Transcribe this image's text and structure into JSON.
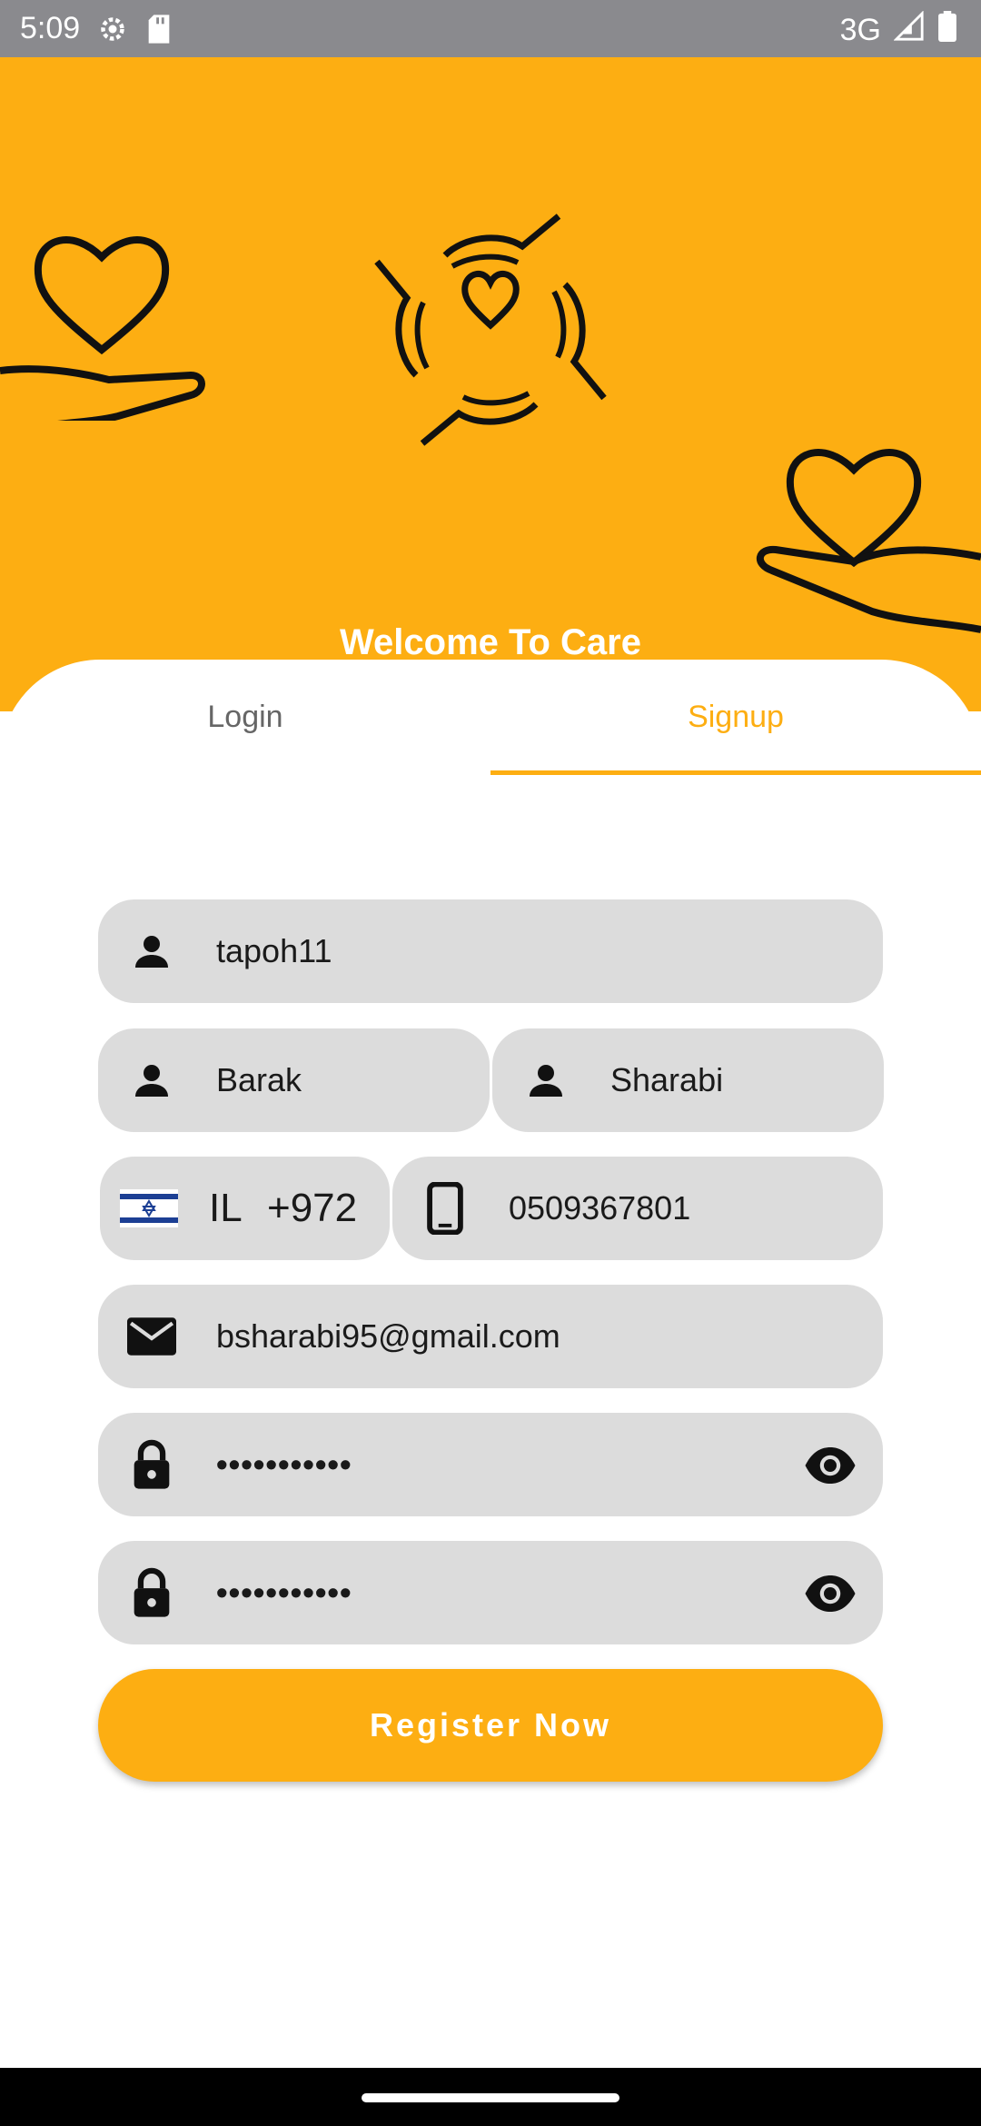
{
  "status_bar": {
    "time": "5:09",
    "network": "3G"
  },
  "hero": {
    "welcome": "Welcome To Care"
  },
  "tabs": {
    "login": "Login",
    "signup": "Signup",
    "active": "signup"
  },
  "form": {
    "username": "tapoh11",
    "first_name": "Barak",
    "last_name": "Sharabi",
    "country_code": "IL",
    "dial_code": "+972",
    "phone": "0509367801",
    "email": "bsharabi95@gmail.com",
    "password_mask": "•••••••••••",
    "confirm_password_mask": "•••••••••••"
  },
  "register_label": "Register Now",
  "colors": {
    "accent": "#fdae12",
    "field_bg": "#dcdcdc"
  }
}
